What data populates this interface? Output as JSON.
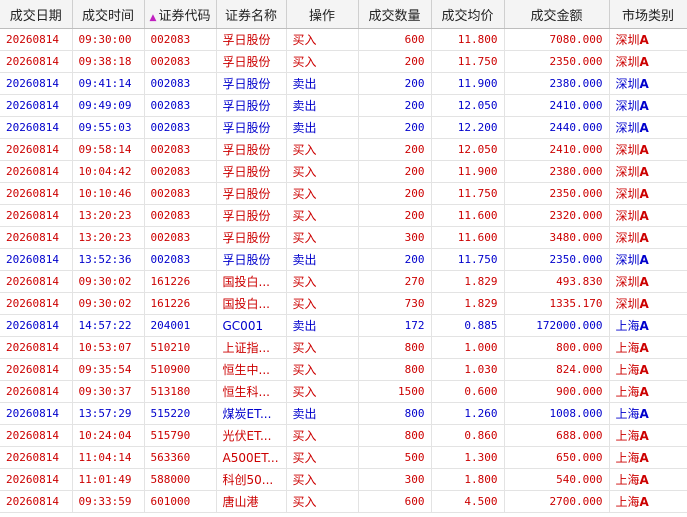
{
  "headers": {
    "date": "成交日期",
    "time": "成交时间",
    "code": "证券代码",
    "name": "证券名称",
    "action": "操作",
    "qty": "成交数量",
    "price": "成交均价",
    "amount": "成交金额",
    "market": "市场类别"
  },
  "sort_icon": "triangle-up",
  "colors": {
    "buy": "#cc0000",
    "sell": "#0000cc",
    "sort": "#c020c0"
  },
  "rows": [
    {
      "date": "20260814",
      "time": "09:30:00",
      "code": "002083",
      "name": "孚日股份",
      "action": "买入",
      "qty": "600",
      "price": "11.800",
      "amount": "7080.000",
      "market": "深圳",
      "market_suffix": "A",
      "side": "buy"
    },
    {
      "date": "20260814",
      "time": "09:38:18",
      "code": "002083",
      "name": "孚日股份",
      "action": "买入",
      "qty": "200",
      "price": "11.750",
      "amount": "2350.000",
      "market": "深圳",
      "market_suffix": "A",
      "side": "buy"
    },
    {
      "date": "20260814",
      "time": "09:41:14",
      "code": "002083",
      "name": "孚日股份",
      "action": "卖出",
      "qty": "200",
      "price": "11.900",
      "amount": "2380.000",
      "market": "深圳",
      "market_suffix": "A",
      "side": "sell"
    },
    {
      "date": "20260814",
      "time": "09:49:09",
      "code": "002083",
      "name": "孚日股份",
      "action": "卖出",
      "qty": "200",
      "price": "12.050",
      "amount": "2410.000",
      "market": "深圳",
      "market_suffix": "A",
      "side": "sell"
    },
    {
      "date": "20260814",
      "time": "09:55:03",
      "code": "002083",
      "name": "孚日股份",
      "action": "卖出",
      "qty": "200",
      "price": "12.200",
      "amount": "2440.000",
      "market": "深圳",
      "market_suffix": "A",
      "side": "sell"
    },
    {
      "date": "20260814",
      "time": "09:58:14",
      "code": "002083",
      "name": "孚日股份",
      "action": "买入",
      "qty": "200",
      "price": "12.050",
      "amount": "2410.000",
      "market": "深圳",
      "market_suffix": "A",
      "side": "buy"
    },
    {
      "date": "20260814",
      "time": "10:04:42",
      "code": "002083",
      "name": "孚日股份",
      "action": "买入",
      "qty": "200",
      "price": "11.900",
      "amount": "2380.000",
      "market": "深圳",
      "market_suffix": "A",
      "side": "buy"
    },
    {
      "date": "20260814",
      "time": "10:10:46",
      "code": "002083",
      "name": "孚日股份",
      "action": "买入",
      "qty": "200",
      "price": "11.750",
      "amount": "2350.000",
      "market": "深圳",
      "market_suffix": "A",
      "side": "buy"
    },
    {
      "date": "20260814",
      "time": "13:20:23",
      "code": "002083",
      "name": "孚日股份",
      "action": "买入",
      "qty": "200",
      "price": "11.600",
      "amount": "2320.000",
      "market": "深圳",
      "market_suffix": "A",
      "side": "buy"
    },
    {
      "date": "20260814",
      "time": "13:20:23",
      "code": "002083",
      "name": "孚日股份",
      "action": "买入",
      "qty": "300",
      "price": "11.600",
      "amount": "3480.000",
      "market": "深圳",
      "market_suffix": "A",
      "side": "buy"
    },
    {
      "date": "20260814",
      "time": "13:52:36",
      "code": "002083",
      "name": "孚日股份",
      "action": "卖出",
      "qty": "200",
      "price": "11.750",
      "amount": "2350.000",
      "market": "深圳",
      "market_suffix": "A",
      "side": "sell"
    },
    {
      "date": "20260814",
      "time": "09:30:02",
      "code": "161226",
      "name": "国投白...",
      "action": "买入",
      "qty": "270",
      "price": "1.829",
      "amount": "493.830",
      "market": "深圳",
      "market_suffix": "A",
      "side": "buy"
    },
    {
      "date": "20260814",
      "time": "09:30:02",
      "code": "161226",
      "name": "国投白...",
      "action": "买入",
      "qty": "730",
      "price": "1.829",
      "amount": "1335.170",
      "market": "深圳",
      "market_suffix": "A",
      "side": "buy"
    },
    {
      "date": "20260814",
      "time": "14:57:22",
      "code": "204001",
      "name": "GC001",
      "action": "卖出",
      "qty": "172",
      "price": "0.885",
      "amount": "172000.000",
      "market": "上海",
      "market_suffix": "A",
      "side": "sell"
    },
    {
      "date": "20260814",
      "time": "10:53:07",
      "code": "510210",
      "name": "上证指...",
      "action": "买入",
      "qty": "800",
      "price": "1.000",
      "amount": "800.000",
      "market": "上海",
      "market_suffix": "A",
      "side": "buy"
    },
    {
      "date": "20260814",
      "time": "09:35:54",
      "code": "510900",
      "name": "恒生中...",
      "action": "买入",
      "qty": "800",
      "price": "1.030",
      "amount": "824.000",
      "market": "上海",
      "market_suffix": "A",
      "side": "buy"
    },
    {
      "date": "20260814",
      "time": "09:30:37",
      "code": "513180",
      "name": "恒生科...",
      "action": "买入",
      "qty": "1500",
      "price": "0.600",
      "amount": "900.000",
      "market": "上海",
      "market_suffix": "A",
      "side": "buy"
    },
    {
      "date": "20260814",
      "time": "13:57:29",
      "code": "515220",
      "name": "煤炭ET...",
      "action": "卖出",
      "qty": "800",
      "price": "1.260",
      "amount": "1008.000",
      "market": "上海",
      "market_suffix": "A",
      "side": "sell"
    },
    {
      "date": "20260814",
      "time": "10:24:04",
      "code": "515790",
      "name": "光伏ET...",
      "action": "买入",
      "qty": "800",
      "price": "0.860",
      "amount": "688.000",
      "market": "上海",
      "market_suffix": "A",
      "side": "buy"
    },
    {
      "date": "20260814",
      "time": "11:04:14",
      "code": "563360",
      "name": "A500ET...",
      "action": "买入",
      "qty": "500",
      "price": "1.300",
      "amount": "650.000",
      "market": "上海",
      "market_suffix": "A",
      "side": "buy"
    },
    {
      "date": "20260814",
      "time": "11:01:49",
      "code": "588000",
      "name": "科创50...",
      "action": "买入",
      "qty": "300",
      "price": "1.800",
      "amount": "540.000",
      "market": "上海",
      "market_suffix": "A",
      "side": "buy"
    },
    {
      "date": "20260814",
      "time": "09:33:59",
      "code": "601000",
      "name": "唐山港",
      "action": "买入",
      "qty": "600",
      "price": "4.500",
      "amount": "2700.000",
      "market": "上海",
      "market_suffix": "A",
      "side": "buy"
    }
  ]
}
